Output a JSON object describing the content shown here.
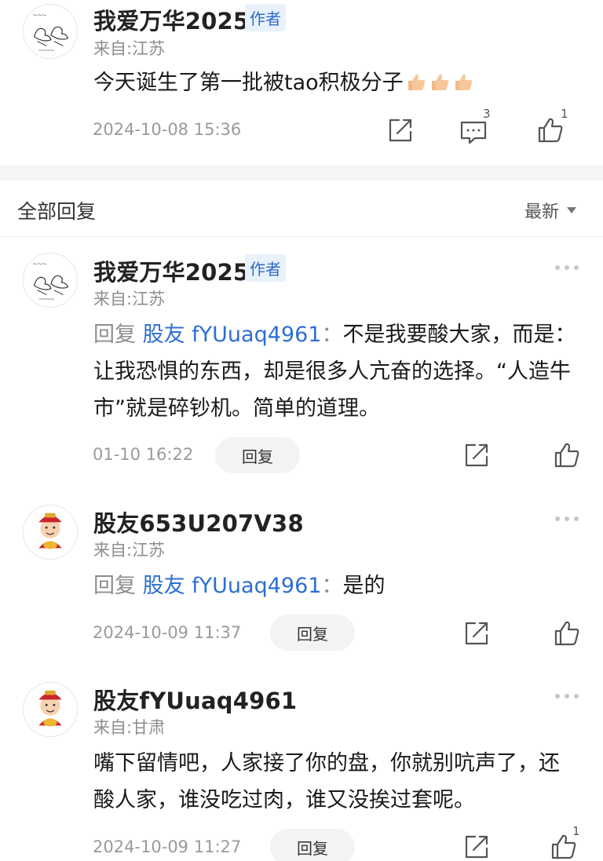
{
  "post": {
    "author": "我爱万华2025",
    "badge": "作者",
    "location": "来自:江苏",
    "content": "今天诞生了第一批被tao积极分子",
    "emoji_name": "thumbs-up-emoji",
    "emoji_count": 3,
    "time": "2024-10-08 15:36",
    "comment_count": "3",
    "like_count": "1"
  },
  "section": {
    "title": "全部回复",
    "sort_label": "最新"
  },
  "replies": [
    {
      "author": "我爱万华2025",
      "badge": "作者",
      "location": "来自:江苏",
      "prefix": "回复",
      "target": "股友 fYUuaq4961",
      "sep": "：",
      "text": "不是我要酸大家，而是：让我恐惧的东西，却是很多人亢奋的选择。“人造牛市”就是碎钞机。简单的道理。",
      "time": "01-10 16:22",
      "reply_label": "回复",
      "like_count": ""
    },
    {
      "author": "股友653U207V38",
      "badge": "",
      "location": "来自:江苏",
      "prefix": "回复",
      "target": "股友 fYUuaq4961",
      "sep": "：",
      "text": "是的",
      "time": "2024-10-09 11:37",
      "reply_label": "回复",
      "like_count": ""
    },
    {
      "author": "股友fYUuaq4961",
      "badge": "",
      "location": "来自:甘肃",
      "prefix": "",
      "target": "",
      "sep": "",
      "text": "嘴下留情吧，人家接了你的盘，你就别吭声了，还酸人家，谁没吃过肉，谁又没挨过套呢。",
      "time": "2024-10-09 11:27",
      "reply_label": "回复",
      "like_count": "1"
    }
  ],
  "icons": {
    "share": "share-icon",
    "comment": "comment-icon",
    "like": "thumbs-up-icon",
    "more": "more-dots-icon"
  },
  "colors": {
    "link": "#2d6fd3",
    "badge_bg": "#e9f1fb",
    "muted": "#8e8e8e"
  }
}
